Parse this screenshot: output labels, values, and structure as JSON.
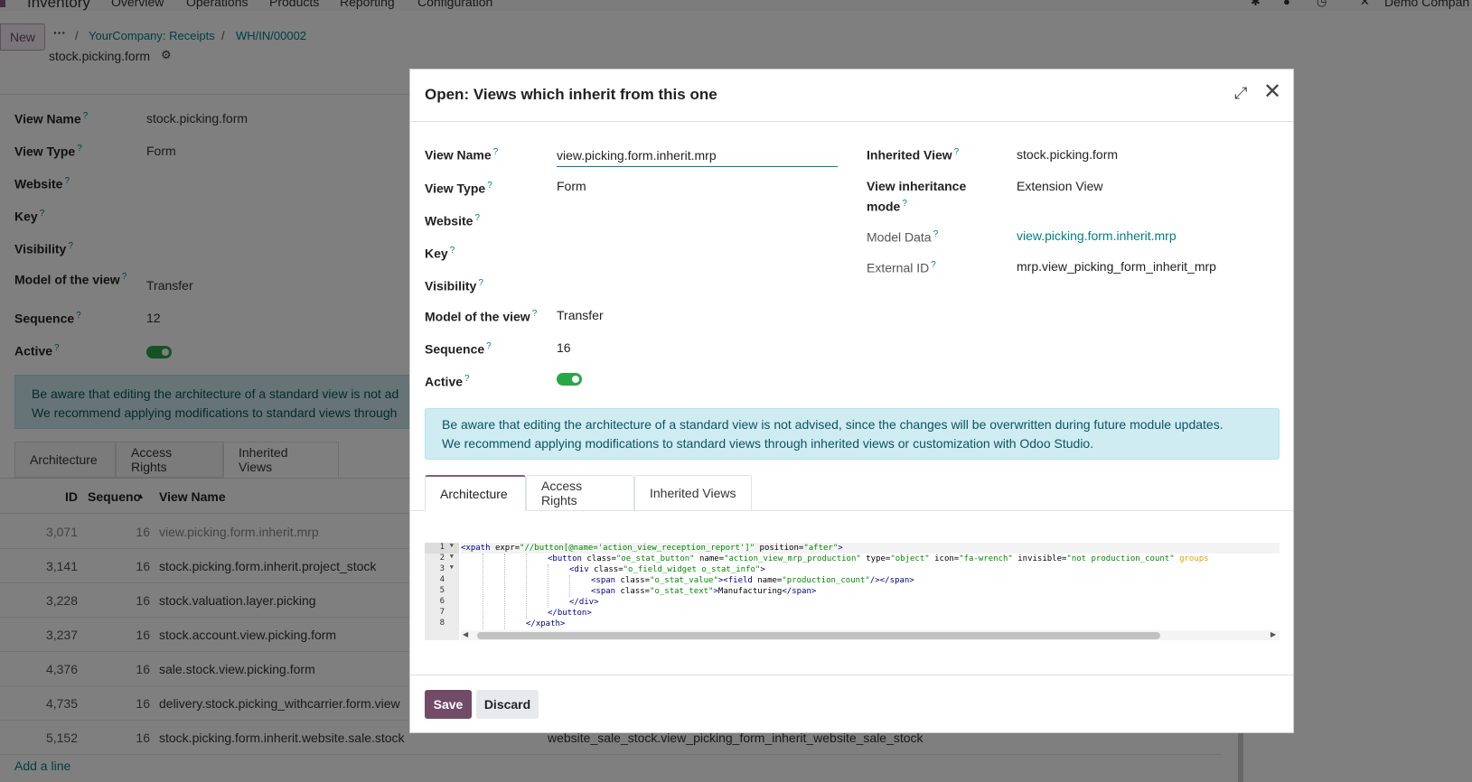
{
  "topbar": {
    "app_name": "Inventory",
    "menus": [
      "Overview",
      "Operations",
      "Products",
      "Reporting",
      "Configuration"
    ],
    "company": "Demo Compan"
  },
  "control_panel": {
    "new_label": "New",
    "more_label": "···",
    "breadcrumbs": [
      "YourCompany: Receipts",
      "WH/IN/00002"
    ],
    "current": "stock.picking.form"
  },
  "background_form": {
    "fields": [
      {
        "label": "View Name",
        "value": "stock.picking.form"
      },
      {
        "label": "View Type",
        "value": "Form"
      },
      {
        "label": "Website",
        "value": ""
      },
      {
        "label": "Key",
        "value": ""
      },
      {
        "label": "Visibility",
        "value": ""
      },
      {
        "label": "Model of the view",
        "value": "Transfer"
      },
      {
        "label": "Sequence",
        "value": "12"
      },
      {
        "label": "Active",
        "value": ""
      }
    ],
    "alert_line1": "Be aware that editing the architecture of a standard view is not ad",
    "alert_line2": "We recommend applying modifications to standard views through",
    "tabs": [
      "Architecture",
      "Access Rights",
      "Inherited Views"
    ],
    "table_headers": {
      "id": "ID",
      "sequence": "Sequenc",
      "name": "View Name"
    },
    "rows": [
      {
        "id": "3,071",
        "seq": "16",
        "name": "view.picking.form.inherit.mrp",
        "key": ""
      },
      {
        "id": "3,141",
        "seq": "16",
        "name": "stock.picking.form.inherit.project_stock",
        "key": ""
      },
      {
        "id": "3,228",
        "seq": "16",
        "name": "stock.valuation.layer.picking",
        "key": ""
      },
      {
        "id": "3,237",
        "seq": "16",
        "name": "stock.account.view.picking.form",
        "key": ""
      },
      {
        "id": "4,376",
        "seq": "16",
        "name": "sale.stock.view.picking.form",
        "key": ""
      },
      {
        "id": "4,735",
        "seq": "16",
        "name": "delivery.stock.picking_withcarrier.form.view",
        "key": ""
      },
      {
        "id": "5,152",
        "seq": "16",
        "name": "stock.picking.form.inherit.website.sale.stock",
        "key": "website_sale_stock.view_picking_form_inherit_website_sale_stock"
      }
    ],
    "add_line": "Add a line"
  },
  "dialog": {
    "title": "Open: Views which inherit from this one",
    "left_fields": {
      "view_name": {
        "label": "View Name",
        "value": "view.picking.form.inherit.mrp"
      },
      "view_type": {
        "label": "View Type",
        "value": "Form"
      },
      "website": {
        "label": "Website"
      },
      "key": {
        "label": "Key"
      },
      "visibility": {
        "label": "Visibility"
      },
      "model": {
        "label": "Model of the view",
        "value": "Transfer"
      },
      "sequence": {
        "label": "Sequence",
        "value": "16"
      },
      "active": {
        "label": "Active"
      }
    },
    "right_fields": {
      "inherited_view": {
        "label": "Inherited View",
        "value": "stock.picking.form"
      },
      "inheritance_mode": {
        "label_line1": "View inheritance",
        "label_line2": "mode",
        "value": "Extension View"
      },
      "model_data": {
        "label": "Model Data",
        "value": "view.picking.form.inherit.mrp"
      },
      "external_id": {
        "label": "External ID",
        "value": "mrp.view_picking_form_inherit_mrp"
      }
    },
    "help_mark": "?",
    "alert_line1": "Be aware that editing the architecture of a standard view is not advised, since the changes will be overwritten during future module updates.",
    "alert_line2": "We recommend applying modifications to standard views through inherited views or customization with Odoo Studio.",
    "tabs": [
      "Architecture",
      "Access Rights",
      "Inherited Views"
    ],
    "code_lines": [
      "1",
      "2",
      "3",
      "4",
      "5",
      "6",
      "7",
      "8"
    ],
    "save_label": "Save",
    "discard_label": "Discard"
  }
}
